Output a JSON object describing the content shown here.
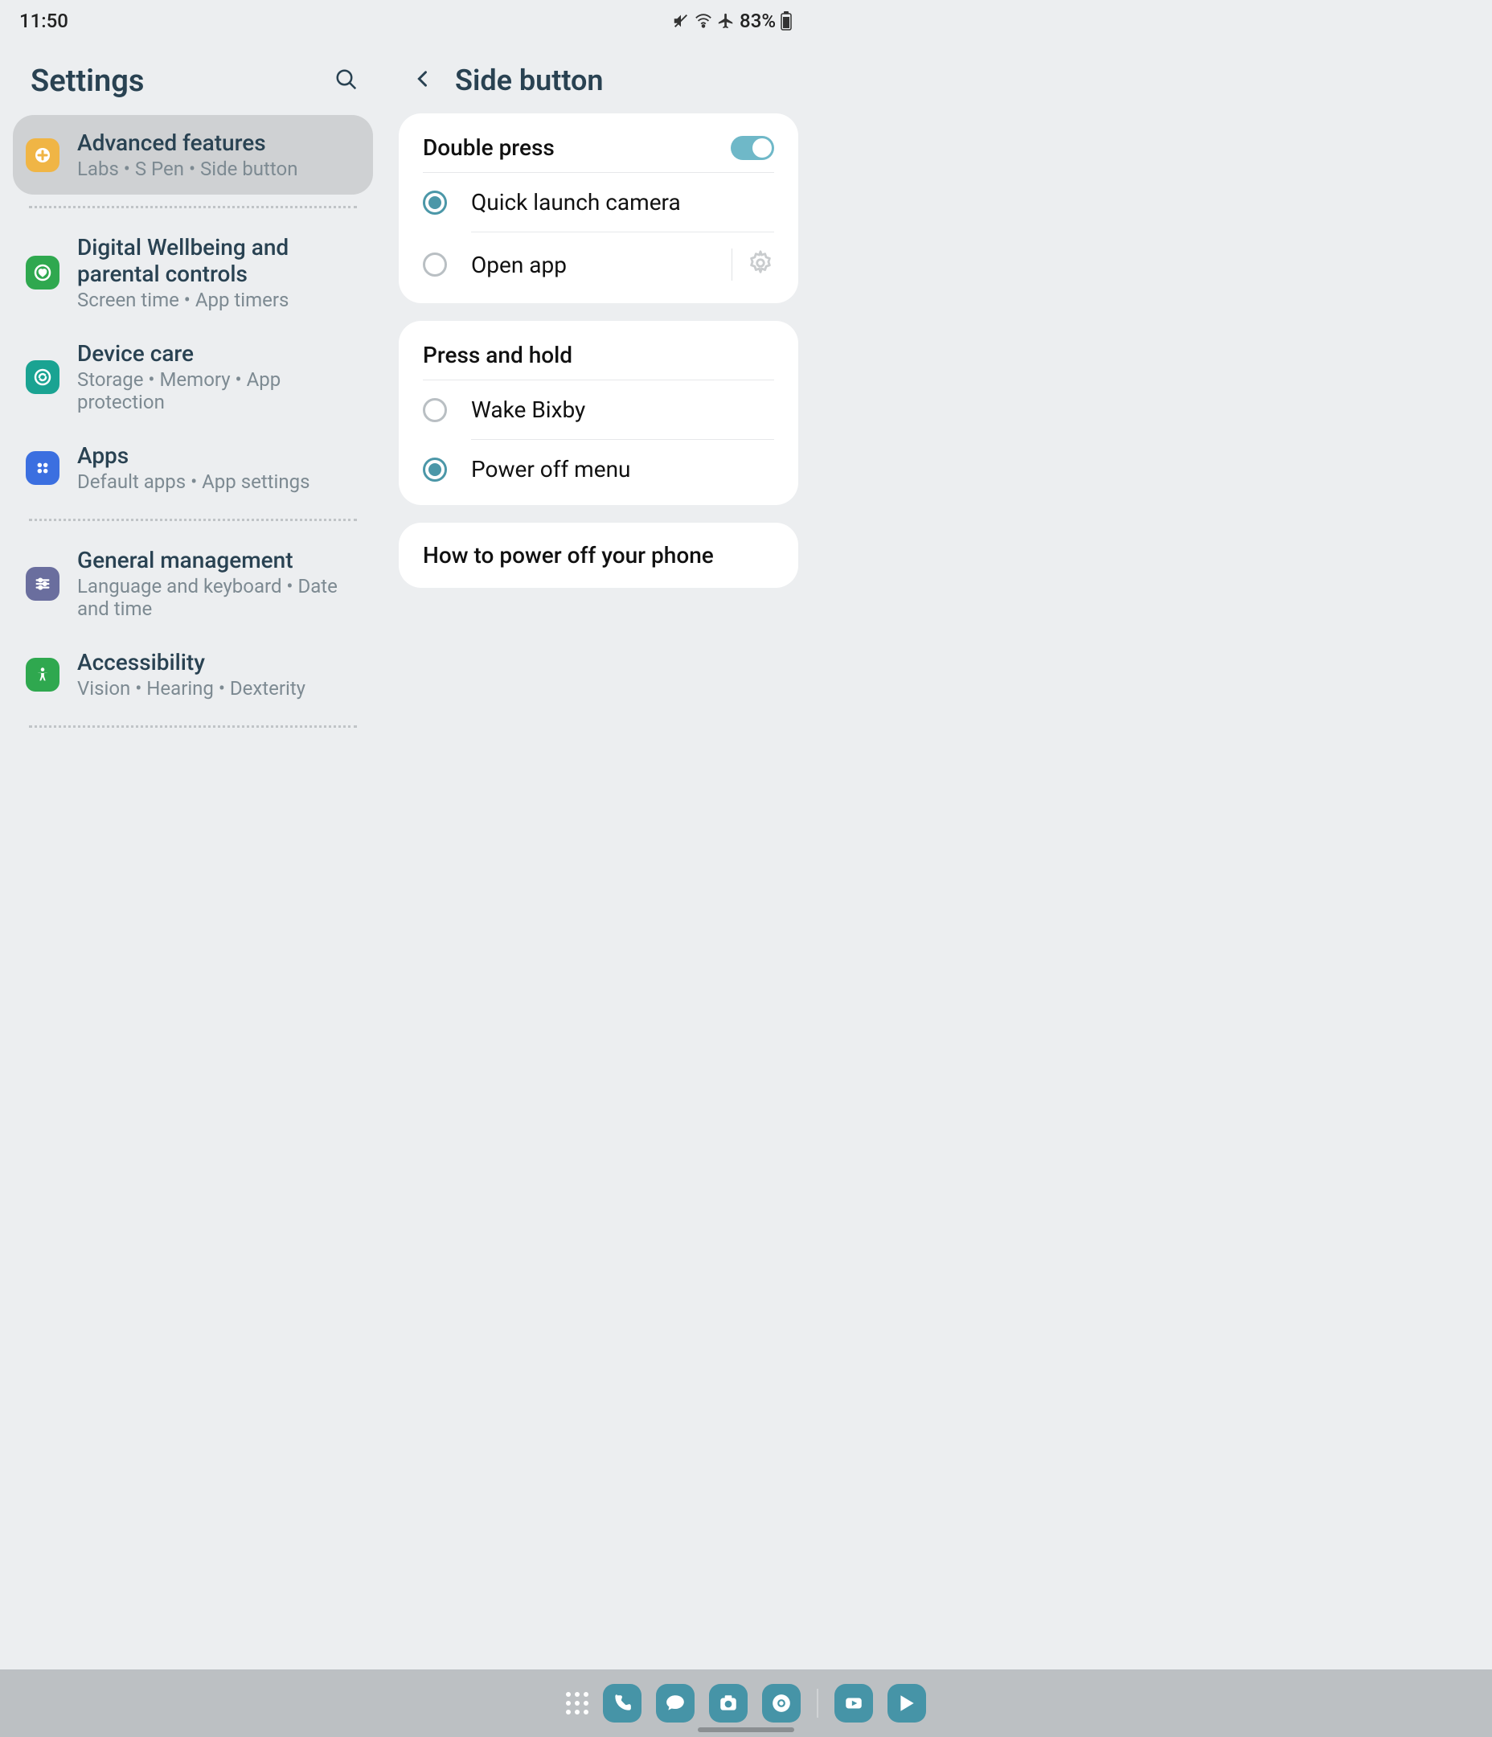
{
  "status": {
    "time": "11:50",
    "battery": "83%"
  },
  "left": {
    "title": "Settings",
    "items": [
      {
        "title": "Advanced features",
        "sub": "Labs  •  S Pen  •  Side button",
        "icon_bg": "#f0b545",
        "svg": "gear-plus"
      },
      {
        "title": "Digital Wellbeing and parental controls",
        "sub": "Screen time  •  App timers",
        "icon_bg": "#2fa84f",
        "svg": "heart-circle"
      },
      {
        "title": "Device care",
        "sub": "Storage  •  Memory  •  App protection",
        "icon_bg": "#1aa392",
        "svg": "refresh-circle"
      },
      {
        "title": "Apps",
        "sub": "Default apps  •  App settings",
        "icon_bg": "#3b6fe0",
        "svg": "four-dots"
      },
      {
        "title": "General management",
        "sub": "Language and keyboard  •  Date and time",
        "icon_bg": "#6a6e9e",
        "svg": "sliders"
      },
      {
        "title": "Accessibility",
        "sub": "Vision  •  Hearing  •  Dexterity",
        "icon_bg": "#2fa84f",
        "svg": "person"
      }
    ]
  },
  "right": {
    "title": "Side button",
    "section1": {
      "title": "Double press",
      "toggled": true,
      "options": [
        {
          "label": "Quick launch camera",
          "checked": true,
          "gear": false
        },
        {
          "label": "Open app",
          "checked": false,
          "gear": true
        }
      ]
    },
    "section2": {
      "title": "Press and hold",
      "options": [
        {
          "label": "Wake Bixby",
          "checked": false
        },
        {
          "label": "Power off menu",
          "checked": true
        }
      ]
    },
    "link": "How to power off your phone"
  }
}
